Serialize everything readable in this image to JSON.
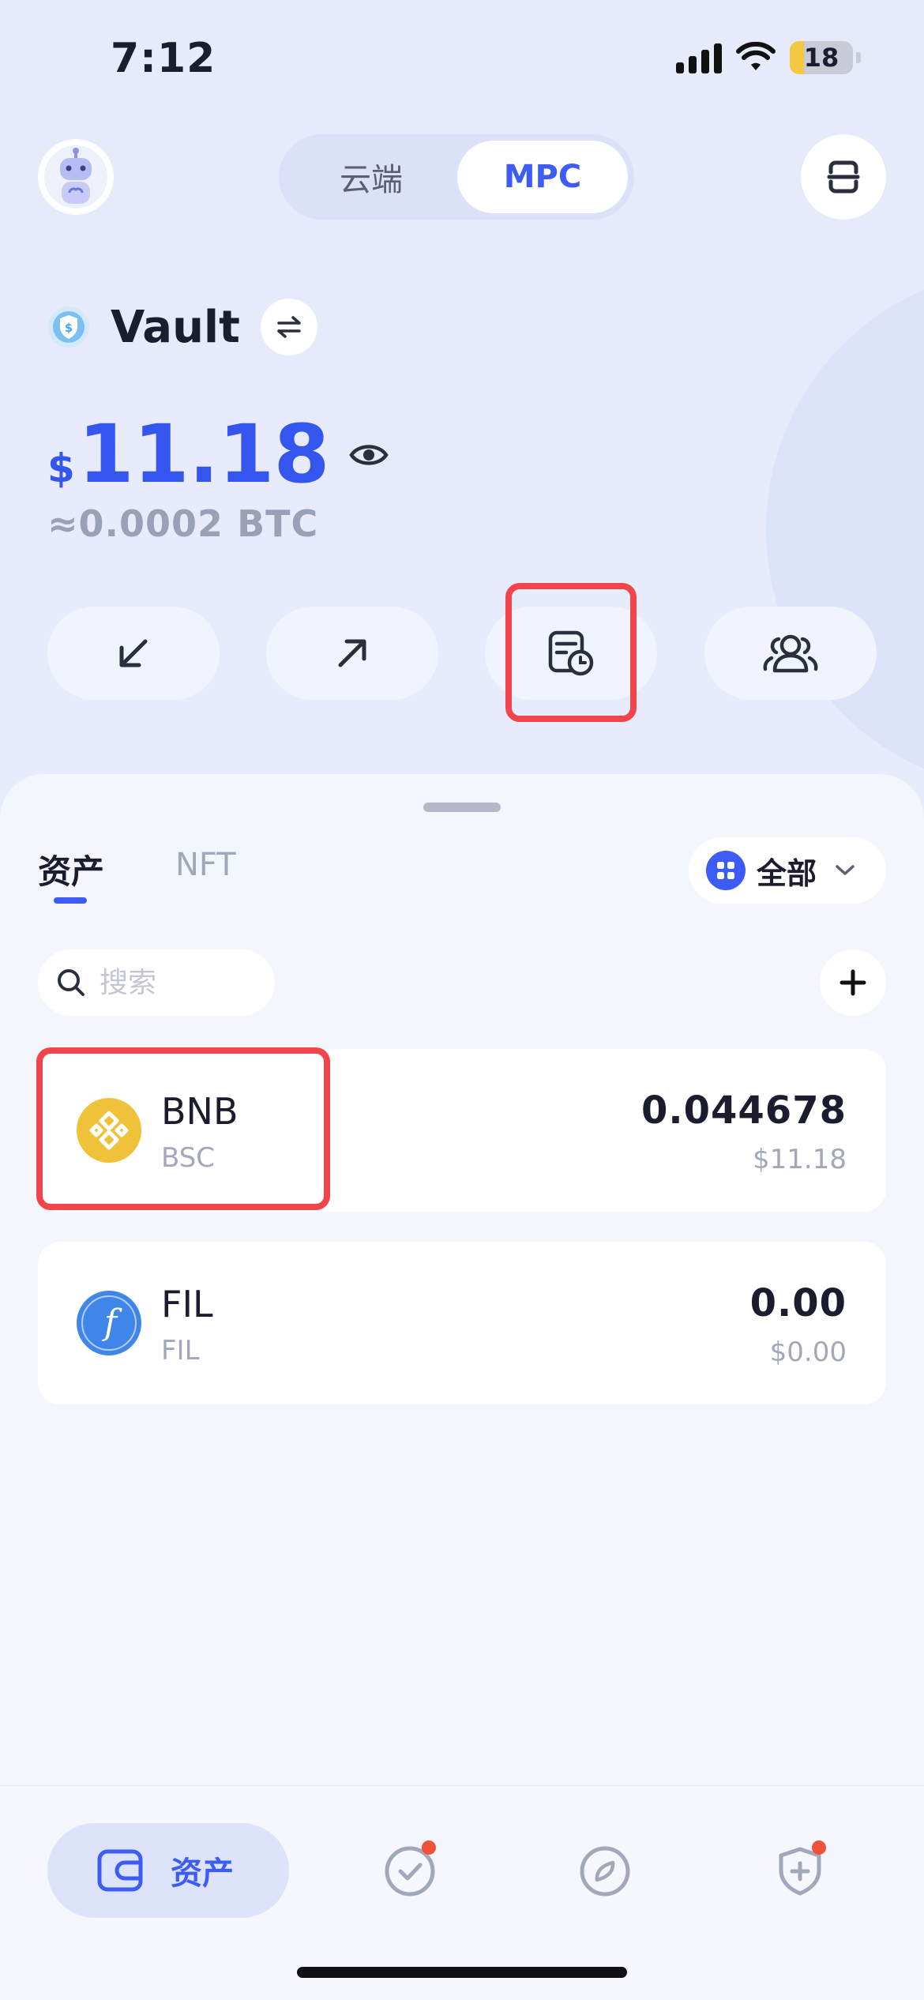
{
  "status_bar": {
    "time": "7:12",
    "battery": "18"
  },
  "header": {
    "mode_tabs": [
      {
        "label": "云端",
        "selected": false
      },
      {
        "label": "MPC",
        "selected": true
      }
    ]
  },
  "wallet": {
    "name": "Vault",
    "balance_currency": "$",
    "balance_amount": "11.18",
    "btc_equivalent": "≈0.0002 BTC"
  },
  "actions": [
    "receive-icon",
    "send-icon",
    "transaction-history-icon",
    "members-icon"
  ],
  "assets_panel": {
    "tabs": [
      {
        "label": "资产",
        "selected": true
      },
      {
        "label": "NFT",
        "selected": false
      }
    ],
    "filter_label": "全部",
    "search_placeholder": "搜索",
    "tokens": [
      {
        "symbol": "BNB",
        "chain": "BSC",
        "amount": "0.044678",
        "value": "$11.18",
        "icon": "bnb-icon",
        "color": "#f0b90b"
      },
      {
        "symbol": "FIL",
        "chain": "FIL",
        "amount": "0.00",
        "value": "$0.00",
        "icon": "filecoin-icon",
        "color": "#3f86e8"
      }
    ]
  },
  "bottom_nav": {
    "items": [
      {
        "label": "资产",
        "icon": "wallet-icon",
        "selected": true
      },
      {
        "icon": "tasks-check-icon",
        "badge": true
      },
      {
        "icon": "discover-compass-icon",
        "badge": false
      },
      {
        "icon": "security-shield-icon",
        "badge": true
      }
    ]
  },
  "colors": {
    "accent": "#3d5bf5",
    "highlight": "#f1444b",
    "badge": "#f0513b"
  }
}
